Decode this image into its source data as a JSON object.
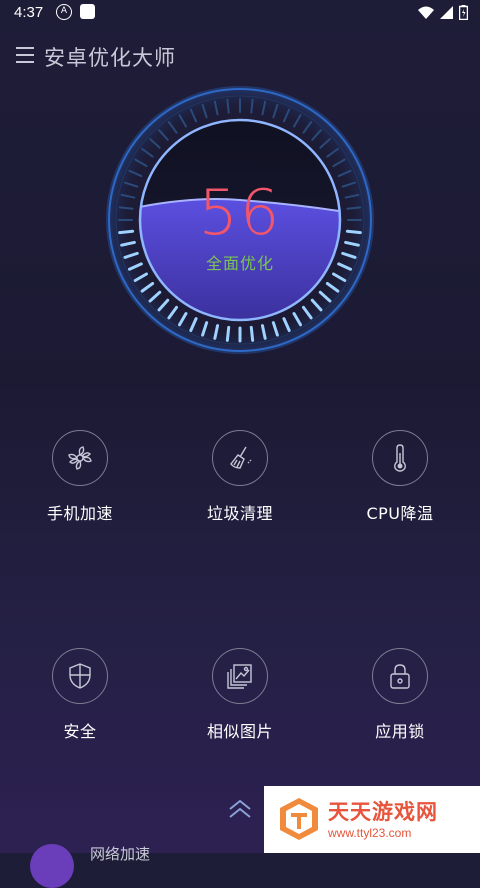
{
  "status_bar": {
    "time": "4:37",
    "a_icon_text": "A"
  },
  "app": {
    "title": "安卓优化大师"
  },
  "gauge": {
    "score": "56",
    "label": "全面优化"
  },
  "tools_row1": [
    {
      "label": "手机加速",
      "icon": "fan-icon"
    },
    {
      "label": "垃圾清理",
      "icon": "broom-icon"
    },
    {
      "label": "CPU降温",
      "icon": "thermometer-icon"
    }
  ],
  "tools_row2": [
    {
      "label": "安全",
      "icon": "shield-icon"
    },
    {
      "label": "相似图片",
      "icon": "images-icon"
    },
    {
      "label": "应用锁",
      "icon": "lock-icon"
    }
  ],
  "bottom": {
    "partial_item": "网络加速"
  },
  "watermark": {
    "title": "天天游戏网",
    "url": "www.ttyl23.com"
  },
  "colors": {
    "score": "#f1566b",
    "label": "#7cc452",
    "ring": "#4aa8ff",
    "watermark": "#e6553c"
  }
}
